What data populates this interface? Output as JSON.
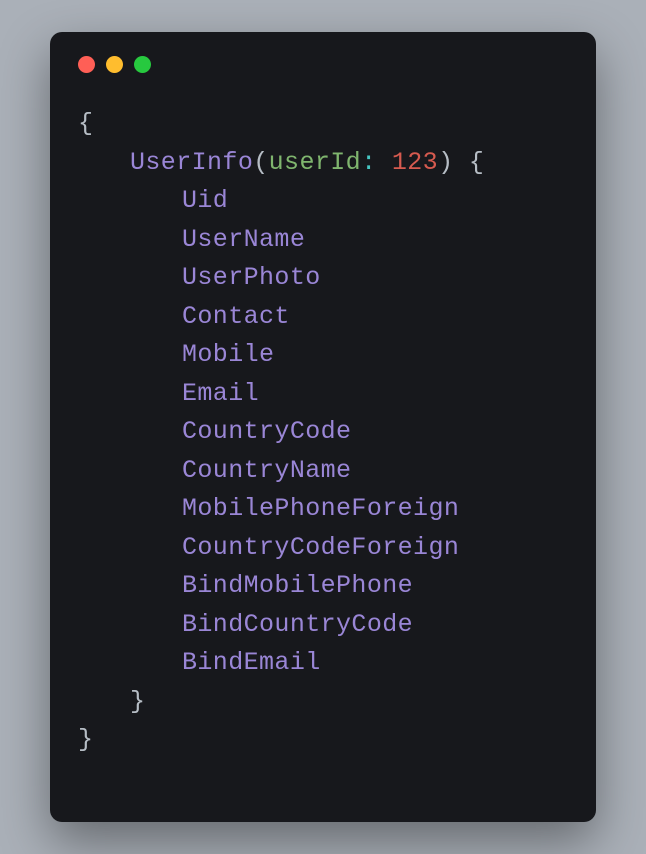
{
  "colors": {
    "background": "#aab0b8",
    "window": "#17181c",
    "traffic_red": "#ff5f56",
    "traffic_yellow": "#ffbd2e",
    "traffic_green": "#27c93f",
    "token_call": "#9a86d6",
    "token_param": "#7fb56e",
    "token_colon": "#46c6c2",
    "token_number": "#d65a4f",
    "token_punct": "#b6bdc5"
  },
  "code": {
    "open_brace": "{",
    "close_brace": "}",
    "open_paren": "(",
    "close_paren": ")",
    "call_name": "UserInfo",
    "param_name": "userId",
    "colon": ":",
    "param_value": "123",
    "space": " ",
    "fields": [
      "Uid",
      "UserName",
      "UserPhoto",
      "Contact",
      "Mobile",
      "Email",
      "CountryCode",
      "CountryName",
      "MobilePhoneForeign",
      "CountryCodeForeign",
      "BindMobilePhone",
      "BindCountryCode",
      "BindEmail"
    ]
  }
}
